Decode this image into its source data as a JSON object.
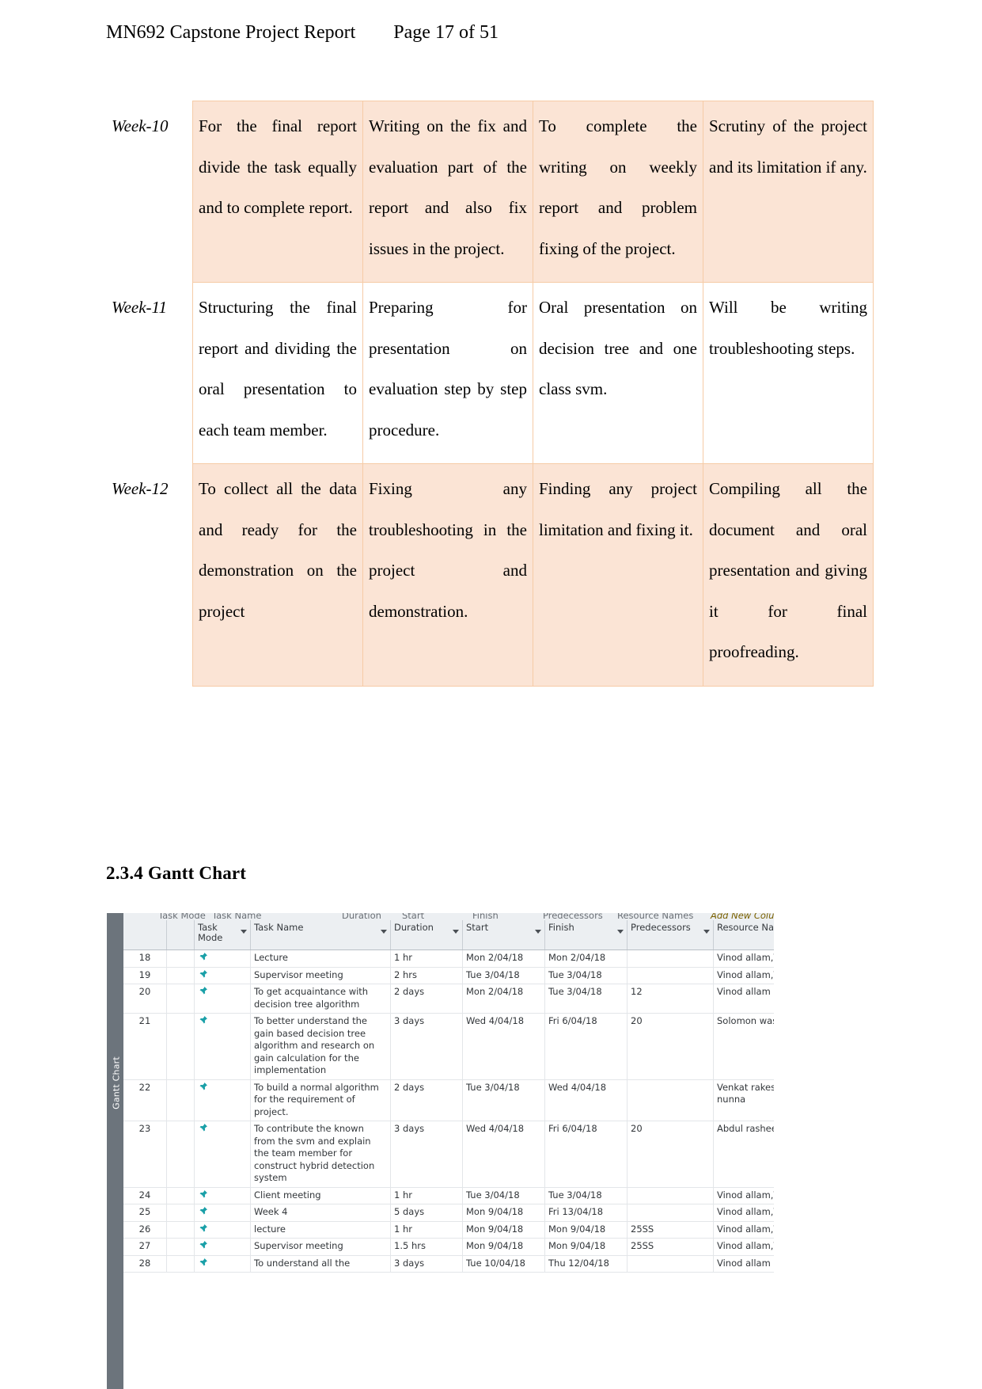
{
  "header": {
    "doc_title": "MN692 Capstone Project Report",
    "page_number": "Page 17 of 51"
  },
  "schedule_table": {
    "rows": [
      {
        "week": "Week-10",
        "shaded": true,
        "cells": [
          "For the final report divide the task equally and to complete report.",
          "Writing on the fix and evaluation part of the report and also fix issues in the project.",
          "To complete the writing on weekly report and problem fixing of the project.",
          "Scrutiny of the project and its limitation if any."
        ]
      },
      {
        "week": "Week-11",
        "shaded": false,
        "cells": [
          "Structuring the final report and dividing the oral presentation to each team member.",
          "Preparing for presentation on evaluation step by step procedure.",
          "Oral presentation on decision tree and one class svm.",
          "Will be writing troubleshooting steps."
        ]
      },
      {
        "week": "Week-12",
        "shaded": true,
        "cells": [
          "To collect all the data and ready for the demonstration on the project",
          "Fixing any troubleshooting in the project and demonstration.",
          "Finding any project limitation and fixing it.",
          "Compiling all the document and oral presentation and giving it for final proofreading."
        ]
      }
    ]
  },
  "section": {
    "heading": "2.3.4 Gantt Chart"
  },
  "gantt_screenshot": {
    "view_label": "Gantt Chart",
    "columns": [
      {
        "key": "task_mode",
        "label": "Task Mode",
        "has_filter": true
      },
      {
        "key": "task_name",
        "label": "Task Name",
        "has_filter": true
      },
      {
        "key": "duration",
        "label": "Duration",
        "has_filter": true
      },
      {
        "key": "start",
        "label": "Start",
        "has_filter": true
      },
      {
        "key": "finish",
        "label": "Finish",
        "has_filter": true
      },
      {
        "key": "predecessors",
        "label": "Predecessors",
        "has_filter": true
      },
      {
        "key": "resource_names",
        "label": "Resource Names",
        "has_filter": true
      },
      {
        "key": "add_new",
        "label": "Add New Column",
        "has_filter": true
      }
    ],
    "mode_icon": "pushpin-icon",
    "rows": [
      {
        "id": "18",
        "task_name": "Lecture",
        "duration": "1 hr",
        "start": "Mon 2/04/18",
        "finish": "Mon 2/04/18",
        "predecessors": "",
        "resource_names": "Vinod allam,Venka"
      },
      {
        "id": "19",
        "task_name": "Supervisor meeting",
        "duration": "2 hrs",
        "start": "Tue 3/04/18",
        "finish": "Tue 3/04/18",
        "predecessors": "",
        "resource_names": "Vinod allam,Venka"
      },
      {
        "id": "20",
        "task_name": "To get acquaintance with decision tree algorithm",
        "duration": "2 days",
        "start": "Mon 2/04/18",
        "finish": "Tue 3/04/18",
        "predecessors": "12",
        "resource_names": "Vinod allam"
      },
      {
        "id": "21",
        "task_name": "To better understand the gain based decision tree algorithm and research on gain calculation for the implementation",
        "duration": "3 days",
        "start": "Wed 4/04/18",
        "finish": "Fri 6/04/18",
        "predecessors": "20",
        "resource_names": "Solomon waskar"
      },
      {
        "id": "22",
        "task_name": "To build a normal algorithm for the requirement of project.",
        "duration": "2 days",
        "start": "Tue 3/04/18",
        "finish": "Wed 4/04/18",
        "predecessors": "",
        "resource_names": "Venkat rakesh nunna"
      },
      {
        "id": "23",
        "task_name": "To contribute the known from the svm and explain the team member for construct hybrid detection system",
        "duration": "3 days",
        "start": "Wed 4/04/18",
        "finish": "Fri 6/04/18",
        "predecessors": "20",
        "resource_names": "Abdul rasheed"
      },
      {
        "id": "24",
        "task_name": "Client meeting",
        "duration": "1 hr",
        "start": "Tue 3/04/18",
        "finish": "Tue 3/04/18",
        "predecessors": "",
        "resource_names": "Vinod allam,Venka"
      },
      {
        "id": "25",
        "task_name": "Week 4",
        "duration": "5 days",
        "start": "Mon 9/04/18",
        "finish": "Fri 13/04/18",
        "predecessors": "",
        "resource_names": "Vinod allam,Venka"
      },
      {
        "id": "26",
        "task_name": "lecture",
        "duration": "1 hr",
        "start": "Mon 9/04/18",
        "finish": "Mon 9/04/18",
        "predecessors": "25SS",
        "resource_names": "Vinod allam,Venka"
      },
      {
        "id": "27",
        "task_name": "Supervisor meeting",
        "duration": "1.5 hrs",
        "start": "Mon 9/04/18",
        "finish": "Mon 9/04/18",
        "predecessors": "25SS",
        "resource_names": "Vinod allam,Venka"
      },
      {
        "id": "28",
        "task_name": "To understand all the",
        "duration": "3 days",
        "start": "Tue 10/04/18",
        "finish": "Thu 12/04/18",
        "predecessors": "",
        "resource_names": "Vinod allam"
      }
    ]
  },
  "colors": {
    "table_shade": "#fbe4d5",
    "table_border": "#f6cba6",
    "msp_header": "#eceff2",
    "msp_addcol": "#ffd24d",
    "msp_viewbar": "#6c747c",
    "pushpin_teal": "#1aa0a8"
  }
}
